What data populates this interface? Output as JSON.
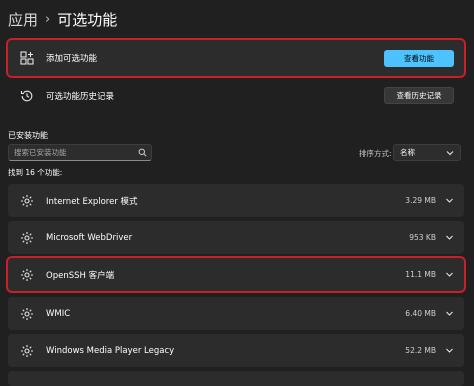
{
  "breadcrumb": {
    "parent": "应用",
    "separator": "›",
    "current": "可选功能"
  },
  "add_feature": {
    "label": "添加可选功能",
    "button": "查看功能"
  },
  "history": {
    "label": "可选功能历史记录",
    "button": "查看历史记录"
  },
  "installed": {
    "title": "已安装功能",
    "search_placeholder": "搜索已安装功能",
    "sort_label": "排序方式:",
    "sort_value": "名称",
    "found_text": "找到 16 个功能:",
    "items": [
      {
        "name": "Internet Explorer 模式",
        "size": "3.29 MB"
      },
      {
        "name": "Microsoft WebDriver",
        "size": "953 KB"
      },
      {
        "name": "OpenSSH 客户端",
        "size": "11.1 MB"
      },
      {
        "name": "WMIC",
        "size": "6.40 MB"
      },
      {
        "name": "Windows Media Player Legacy",
        "size": "52.2 MB"
      }
    ]
  },
  "colors": {
    "accent": "#4cc2ff",
    "highlight": "#c7202a",
    "background": "#202020",
    "card": "#2c2c2c"
  },
  "icons": [
    "grid-plus-icon",
    "history-icon",
    "search-icon",
    "chevron-down-icon",
    "gear-icon"
  ]
}
